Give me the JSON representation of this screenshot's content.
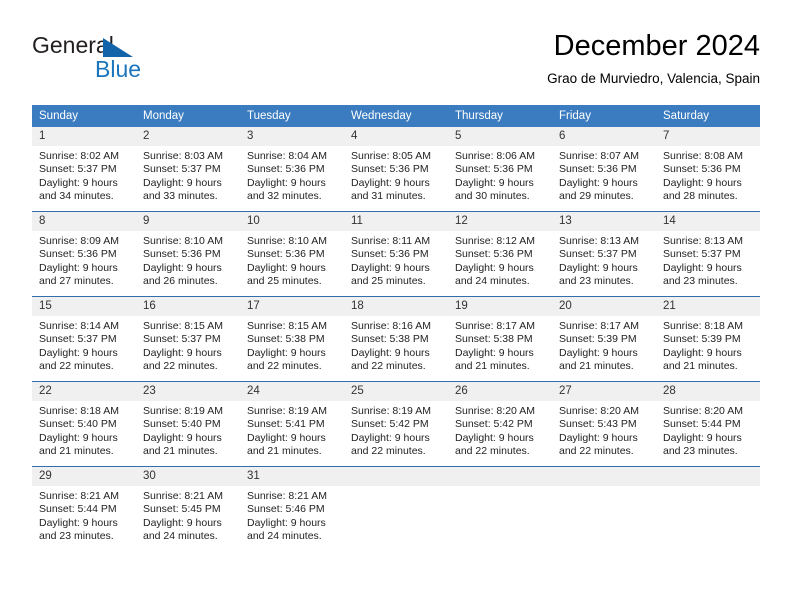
{
  "brand": {
    "name_part1": "General",
    "name_part2": "Blue",
    "logo_icon": "blue-triangle-icon"
  },
  "header": {
    "title": "December 2024",
    "subtitle": "Grao de Murviedro, Valencia, Spain"
  },
  "weekday_headers": [
    "Sunday",
    "Monday",
    "Tuesday",
    "Wednesday",
    "Thursday",
    "Friday",
    "Saturday"
  ],
  "labels": {
    "sunrise_prefix": "Sunrise:",
    "sunset_prefix": "Sunset:",
    "daylight_prefix": "Daylight:"
  },
  "colors": {
    "header_blue": "#3b7cc0",
    "row_separator_blue": "#2f6fae",
    "daynum_band": "#f0f0f0",
    "brand_blue": "#1b75bc",
    "logo_triangle": "#1464aa",
    "text": "#232323"
  },
  "weeks": [
    [
      {
        "day": "1",
        "line1": "Sunrise: 8:02 AM",
        "line2": "Sunset: 5:37 PM",
        "line3": "Daylight: 9 hours",
        "line4": "and 34 minutes."
      },
      {
        "day": "2",
        "line1": "Sunrise: 8:03 AM",
        "line2": "Sunset: 5:37 PM",
        "line3": "Daylight: 9 hours",
        "line4": "and 33 minutes."
      },
      {
        "day": "3",
        "line1": "Sunrise: 8:04 AM",
        "line2": "Sunset: 5:36 PM",
        "line3": "Daylight: 9 hours",
        "line4": "and 32 minutes."
      },
      {
        "day": "4",
        "line1": "Sunrise: 8:05 AM",
        "line2": "Sunset: 5:36 PM",
        "line3": "Daylight: 9 hours",
        "line4": "and 31 minutes."
      },
      {
        "day": "5",
        "line1": "Sunrise: 8:06 AM",
        "line2": "Sunset: 5:36 PM",
        "line3": "Daylight: 9 hours",
        "line4": "and 30 minutes."
      },
      {
        "day": "6",
        "line1": "Sunrise: 8:07 AM",
        "line2": "Sunset: 5:36 PM",
        "line3": "Daylight: 9 hours",
        "line4": "and 29 minutes."
      },
      {
        "day": "7",
        "line1": "Sunrise: 8:08 AM",
        "line2": "Sunset: 5:36 PM",
        "line3": "Daylight: 9 hours",
        "line4": "and 28 minutes."
      }
    ],
    [
      {
        "day": "8",
        "line1": "Sunrise: 8:09 AM",
        "line2": "Sunset: 5:36 PM",
        "line3": "Daylight: 9 hours",
        "line4": "and 27 minutes."
      },
      {
        "day": "9",
        "line1": "Sunrise: 8:10 AM",
        "line2": "Sunset: 5:36 PM",
        "line3": "Daylight: 9 hours",
        "line4": "and 26 minutes."
      },
      {
        "day": "10",
        "line1": "Sunrise: 8:10 AM",
        "line2": "Sunset: 5:36 PM",
        "line3": "Daylight: 9 hours",
        "line4": "and 25 minutes."
      },
      {
        "day": "11",
        "line1": "Sunrise: 8:11 AM",
        "line2": "Sunset: 5:36 PM",
        "line3": "Daylight: 9 hours",
        "line4": "and 25 minutes."
      },
      {
        "day": "12",
        "line1": "Sunrise: 8:12 AM",
        "line2": "Sunset: 5:36 PM",
        "line3": "Daylight: 9 hours",
        "line4": "and 24 minutes."
      },
      {
        "day": "13",
        "line1": "Sunrise: 8:13 AM",
        "line2": "Sunset: 5:37 PM",
        "line3": "Daylight: 9 hours",
        "line4": "and 23 minutes."
      },
      {
        "day": "14",
        "line1": "Sunrise: 8:13 AM",
        "line2": "Sunset: 5:37 PM",
        "line3": "Daylight: 9 hours",
        "line4": "and 23 minutes."
      }
    ],
    [
      {
        "day": "15",
        "line1": "Sunrise: 8:14 AM",
        "line2": "Sunset: 5:37 PM",
        "line3": "Daylight: 9 hours",
        "line4": "and 22 minutes."
      },
      {
        "day": "16",
        "line1": "Sunrise: 8:15 AM",
        "line2": "Sunset: 5:37 PM",
        "line3": "Daylight: 9 hours",
        "line4": "and 22 minutes."
      },
      {
        "day": "17",
        "line1": "Sunrise: 8:15 AM",
        "line2": "Sunset: 5:38 PM",
        "line3": "Daylight: 9 hours",
        "line4": "and 22 minutes."
      },
      {
        "day": "18",
        "line1": "Sunrise: 8:16 AM",
        "line2": "Sunset: 5:38 PM",
        "line3": "Daylight: 9 hours",
        "line4": "and 22 minutes."
      },
      {
        "day": "19",
        "line1": "Sunrise: 8:17 AM",
        "line2": "Sunset: 5:38 PM",
        "line3": "Daylight: 9 hours",
        "line4": "and 21 minutes."
      },
      {
        "day": "20",
        "line1": "Sunrise: 8:17 AM",
        "line2": "Sunset: 5:39 PM",
        "line3": "Daylight: 9 hours",
        "line4": "and 21 minutes."
      },
      {
        "day": "21",
        "line1": "Sunrise: 8:18 AM",
        "line2": "Sunset: 5:39 PM",
        "line3": "Daylight: 9 hours",
        "line4": "and 21 minutes."
      }
    ],
    [
      {
        "day": "22",
        "line1": "Sunrise: 8:18 AM",
        "line2": "Sunset: 5:40 PM",
        "line3": "Daylight: 9 hours",
        "line4": "and 21 minutes."
      },
      {
        "day": "23",
        "line1": "Sunrise: 8:19 AM",
        "line2": "Sunset: 5:40 PM",
        "line3": "Daylight: 9 hours",
        "line4": "and 21 minutes."
      },
      {
        "day": "24",
        "line1": "Sunrise: 8:19 AM",
        "line2": "Sunset: 5:41 PM",
        "line3": "Daylight: 9 hours",
        "line4": "and 21 minutes."
      },
      {
        "day": "25",
        "line1": "Sunrise: 8:19 AM",
        "line2": "Sunset: 5:42 PM",
        "line3": "Daylight: 9 hours",
        "line4": "and 22 minutes."
      },
      {
        "day": "26",
        "line1": "Sunrise: 8:20 AM",
        "line2": "Sunset: 5:42 PM",
        "line3": "Daylight: 9 hours",
        "line4": "and 22 minutes."
      },
      {
        "day": "27",
        "line1": "Sunrise: 8:20 AM",
        "line2": "Sunset: 5:43 PM",
        "line3": "Daylight: 9 hours",
        "line4": "and 22 minutes."
      },
      {
        "day": "28",
        "line1": "Sunrise: 8:20 AM",
        "line2": "Sunset: 5:44 PM",
        "line3": "Daylight: 9 hours",
        "line4": "and 23 minutes."
      }
    ],
    [
      {
        "day": "29",
        "line1": "Sunrise: 8:21 AM",
        "line2": "Sunset: 5:44 PM",
        "line3": "Daylight: 9 hours",
        "line4": "and 23 minutes."
      },
      {
        "day": "30",
        "line1": "Sunrise: 8:21 AM",
        "line2": "Sunset: 5:45 PM",
        "line3": "Daylight: 9 hours",
        "line4": "and 24 minutes."
      },
      {
        "day": "31",
        "line1": "Sunrise: 8:21 AM",
        "line2": "Sunset: 5:46 PM",
        "line3": "Daylight: 9 hours",
        "line4": "and 24 minutes."
      },
      {
        "day": "",
        "line1": "",
        "line2": "",
        "line3": "",
        "line4": ""
      },
      {
        "day": "",
        "line1": "",
        "line2": "",
        "line3": "",
        "line4": ""
      },
      {
        "day": "",
        "line1": "",
        "line2": "",
        "line3": "",
        "line4": ""
      },
      {
        "day": "",
        "line1": "",
        "line2": "",
        "line3": "",
        "line4": ""
      }
    ]
  ]
}
